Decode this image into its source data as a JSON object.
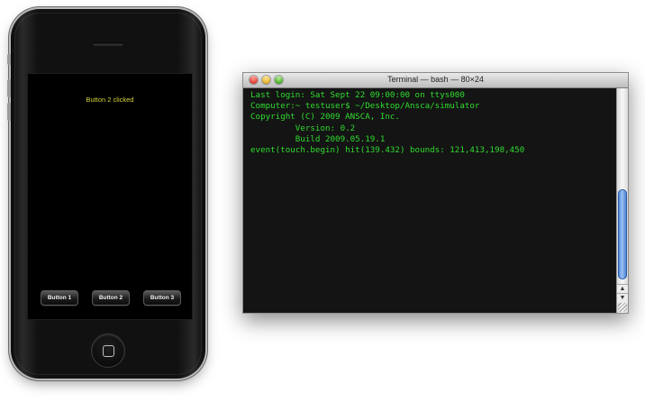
{
  "simulator": {
    "status_text": "Button 2 clicked",
    "buttons": [
      {
        "label": "Button 1"
      },
      {
        "label": "Button 2"
      },
      {
        "label": "Button 3"
      }
    ]
  },
  "terminal": {
    "title": "Terminal — bash — 80×24",
    "lines": [
      "Last login: Sat Sept 22 09:00:00 on ttys000",
      "Computer:~ testuser$ ~/Desktop/Ansca/simulator",
      "Copyright (C) 2009 ANSCA, Inc.",
      "         Version: 0.2",
      "         Build 2009.05.19.1",
      "event(touch.begin) hit(139.432) bounds: 121,413,198,450"
    ],
    "scroll_up_glyph": "▲",
    "scroll_down_glyph": "▼"
  },
  "colors": {
    "terminal_text": "#2fdc2f",
    "status_text": "#d8d43c",
    "close": "#e5463c",
    "minimize": "#e8b52a",
    "zoom": "#4fb52e",
    "scroll_thumb": "#3c7ad4"
  },
  "icons": {
    "close": "close-icon",
    "minimize": "minimize-icon",
    "zoom": "zoom-icon",
    "home": "home-button-icon"
  }
}
